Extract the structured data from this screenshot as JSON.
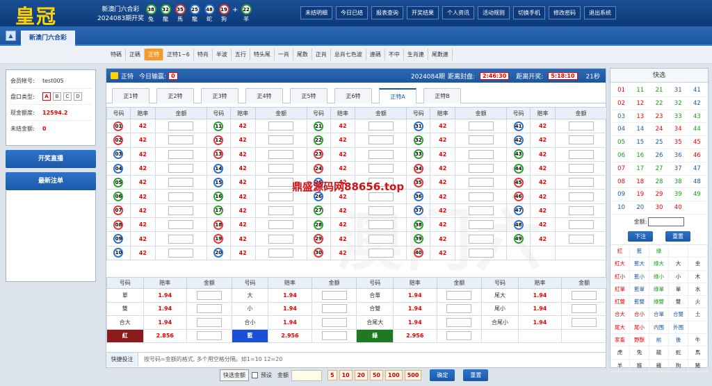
{
  "header": {
    "logo": "皇冠",
    "lottery_name": "新澳门六合彩",
    "draw_label": "2024083期开奖",
    "balls": [
      {
        "num": "38",
        "zodiac": "兔",
        "color": "#29a329"
      },
      {
        "num": "32",
        "zodiac": "龍",
        "color": "#29a329"
      },
      {
        "num": "35",
        "zodiac": "馬",
        "color": "#e33333"
      },
      {
        "num": "25",
        "zodiac": "龍",
        "color": "#2a6fd6"
      },
      {
        "num": "48",
        "zodiac": "蛇",
        "color": "#2a6fd6"
      },
      {
        "num": "19",
        "zodiac": "狗",
        "color": "#e33333"
      },
      {
        "num": "22",
        "zodiac": "羊",
        "color": "#29a329"
      }
    ],
    "plus": "+",
    "nav": [
      "未结明细",
      "今日已结",
      "报表查询",
      "开奖结果",
      "个人资讯",
      "活动规则",
      "切换手机",
      "修改密码",
      "退出系统"
    ]
  },
  "tabbar": {
    "home_icon": "home-icon",
    "game_tab": "新澳门六合彩"
  },
  "subnav": [
    "特碼",
    "正碼",
    "正特",
    "正特1~6",
    "特肖",
    "半波",
    "五行",
    "特头尾",
    "一肖",
    "尾数",
    "正肖",
    "总肖七色波",
    "連碼",
    "不中",
    "生肖連",
    "尾數連"
  ],
  "subnav_active": "正特",
  "account": {
    "account_label": "会员帐号:",
    "account_value": "test005",
    "plate_label": "盘口类型:",
    "plates": [
      "A",
      "B",
      "C",
      "D"
    ],
    "quota_label": "现金额度:",
    "quota_value": "12594.2",
    "unsettled_label": "未结金额:",
    "unsettled_value": "0",
    "live_button": "开奖直播",
    "latest_bets": "最新注单"
  },
  "main_head": {
    "game": "正特",
    "today_label": "今日输赢:",
    "today_value": "0",
    "period": "2024084期",
    "close_label": "距离封盘:",
    "close_value": "2:46:30",
    "open_label": "距离开奖:",
    "open_value": "5:18:10",
    "countdown": "21秒"
  },
  "sub_tabs": [
    "正1特",
    "正2特",
    "正3特",
    "正4特",
    "正5特",
    "正6特",
    "正特A",
    "正特B"
  ],
  "sub_tab_active": "正特A",
  "grid_headers": {
    "num": "号码",
    "odds": "赔率",
    "amount": "金额"
  },
  "odds_value": "42",
  "watermark": "鼎盛源码网88656.top",
  "bg_watermark": "澳门六",
  "special_headers": {
    "num": "号码",
    "odds": "赔率",
    "amount": "金额"
  },
  "special_rows": [
    [
      {
        "name": "單",
        "odds": "1.94"
      },
      {
        "name": "大",
        "odds": "1.94"
      },
      {
        "name": "合單",
        "odds": "1.94"
      },
      {
        "name": "尾大",
        "odds": "1.94"
      }
    ],
    [
      {
        "name": "雙",
        "odds": "1.94"
      },
      {
        "name": "小",
        "odds": "1.94"
      },
      {
        "name": "合雙",
        "odds": "1.94"
      },
      {
        "name": "尾小",
        "odds": "1.94"
      }
    ],
    [
      {
        "name": "合大",
        "odds": "1.94"
      },
      {
        "name": "合小",
        "odds": "1.94"
      },
      {
        "name": "合尾大",
        "odds": "1.94"
      },
      {
        "name": "合尾小",
        "odds": "1.94"
      }
    ],
    [
      {
        "name": "紅",
        "odds": "2.856",
        "bg": "#8b1a1a"
      },
      {
        "name": "藍",
        "odds": "2.956",
        "bg": "#1a4fd6"
      },
      {
        "name": "綠",
        "odds": "2.956",
        "bg": "#1e7a1e"
      },
      {
        "name": "",
        "odds": ""
      }
    ]
  ],
  "quick_bet": {
    "label": "快捷投注",
    "placeholder": "按号码=金额的格式, 多个用空格分隔。如1=10 12=20"
  },
  "bottom": {
    "quick_amount_btn": "快选金额",
    "preset_label": "预设",
    "amount_label": "金额",
    "chips": [
      "5",
      "10",
      "20",
      "50",
      "100",
      "500"
    ],
    "confirm": "确定",
    "reset": "重置"
  },
  "quick_panel": {
    "title": "快选",
    "numbers": [
      [
        "01",
        "11",
        "21",
        "31",
        "41"
      ],
      [
        "02",
        "12",
        "22",
        "32",
        "42"
      ],
      [
        "03",
        "13",
        "23",
        "33",
        "43"
      ],
      [
        "04",
        "14",
        "24",
        "34",
        "44"
      ],
      [
        "05",
        "15",
        "25",
        "35",
        "45"
      ],
      [
        "06",
        "16",
        "26",
        "36",
        "46"
      ],
      [
        "07",
        "17",
        "27",
        "37",
        "47"
      ],
      [
        "08",
        "18",
        "28",
        "38",
        "48"
      ],
      [
        "09",
        "19",
        "29",
        "39",
        "49"
      ],
      [
        "10",
        "20",
        "30",
        "40"
      ]
    ],
    "amount_label": "金额:",
    "submit": "下注",
    "reset": "重置",
    "categories": [
      [
        "紅",
        "藍",
        "綠",
        "",
        ""
      ],
      [
        "紅大",
        "藍大",
        "綠大",
        "大",
        "金"
      ],
      [
        "紅小",
        "藍小",
        "綠小",
        "小",
        "木"
      ],
      [
        "紅單",
        "藍單",
        "綠單",
        "單",
        "水"
      ],
      [
        "紅雙",
        "藍雙",
        "綠雙",
        "雙",
        "火"
      ],
      [
        "合大",
        "合小",
        "合單",
        "合雙",
        "土"
      ],
      [
        "尾大",
        "尾小",
        "内围",
        "外围",
        ""
      ],
      [
        "家畜",
        "野獸",
        "前",
        "後",
        "牛"
      ],
      [
        "虎",
        "兔",
        "龍",
        "蛇",
        "馬"
      ],
      [
        "羊",
        "猴",
        "雞",
        "狗",
        "豬"
      ]
    ]
  }
}
